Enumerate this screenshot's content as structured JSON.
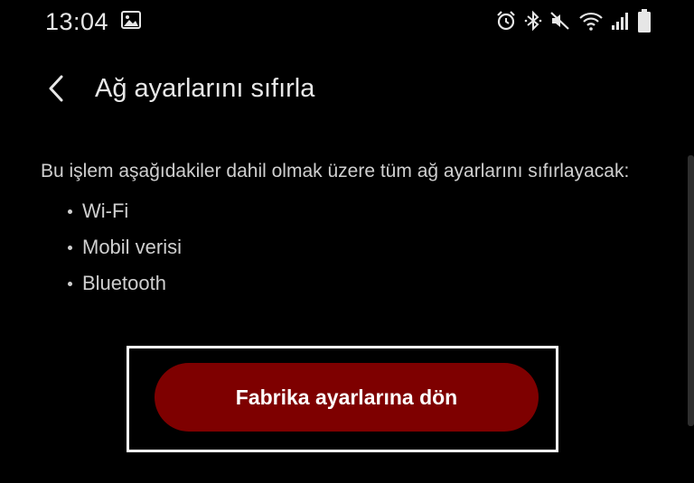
{
  "status_bar": {
    "time": "13:04",
    "icons": [
      "gallery-icon",
      "alarm-icon",
      "bluetooth-icon",
      "mute-icon",
      "wifi-icon",
      "signal-icon",
      "battery-icon"
    ]
  },
  "header": {
    "back_icon": "chevron-left-icon",
    "title": "Ağ ayarlarını sıfırla"
  },
  "content": {
    "description": "Bu işlem aşağıdakiler dahil olmak üzere tüm ağ ayarlarını sıfırlayacak:",
    "items": [
      "Wi-Fi",
      "Mobil verisi",
      "Bluetooth"
    ]
  },
  "action": {
    "reset_label": "Fabrika ayarlarına dön"
  },
  "colors": {
    "background": "#000000",
    "button": "#7e0000",
    "highlight_frame": "#ffffff"
  }
}
